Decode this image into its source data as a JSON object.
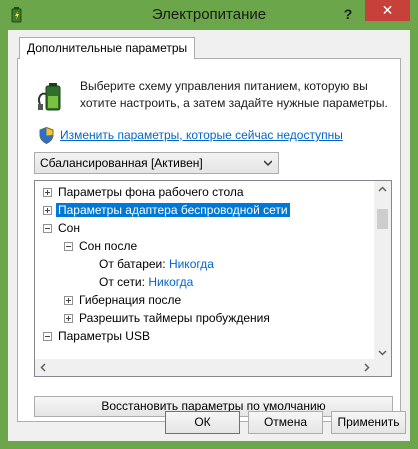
{
  "window": {
    "title": "Электропитание",
    "help_label": "?",
    "close_label": "✕"
  },
  "tab": {
    "label": "Дополнительные параметры"
  },
  "description": "Выберите схему управления питанием, которую вы хотите настроить, а затем задайте нужные параметры.",
  "change_link": "Изменить параметры, которые сейчас недоступны",
  "plan_select": {
    "value": "Сбалансированная [Активен]"
  },
  "tree": {
    "items": [
      {
        "label": "Параметры фона рабочего стола",
        "expander": "plus"
      },
      {
        "label": "Параметры адаптера беспроводной сети",
        "expander": "plus",
        "selected": true
      },
      {
        "label": "Сон",
        "expander": "minus"
      },
      {
        "label": "Сон после",
        "expander": "minus"
      },
      {
        "label": "От батареи:",
        "value": "Никогда"
      },
      {
        "label": "От сети:",
        "value": "Никогда"
      },
      {
        "label": "Гибернация после",
        "expander": "plus"
      },
      {
        "label": "Разрешить таймеры пробуждения",
        "expander": "plus"
      },
      {
        "label": "Параметры USB",
        "expander": "minus"
      }
    ]
  },
  "restore_button": "Восстановить параметры по умолчанию",
  "buttons": {
    "ok": "ОК",
    "cancel": "Отмена",
    "apply": "Применить"
  },
  "colors": {
    "window_frame": "#6ba64a",
    "close_button": "#c7403a",
    "link": "#0066cc",
    "selection": "#0078d7"
  }
}
